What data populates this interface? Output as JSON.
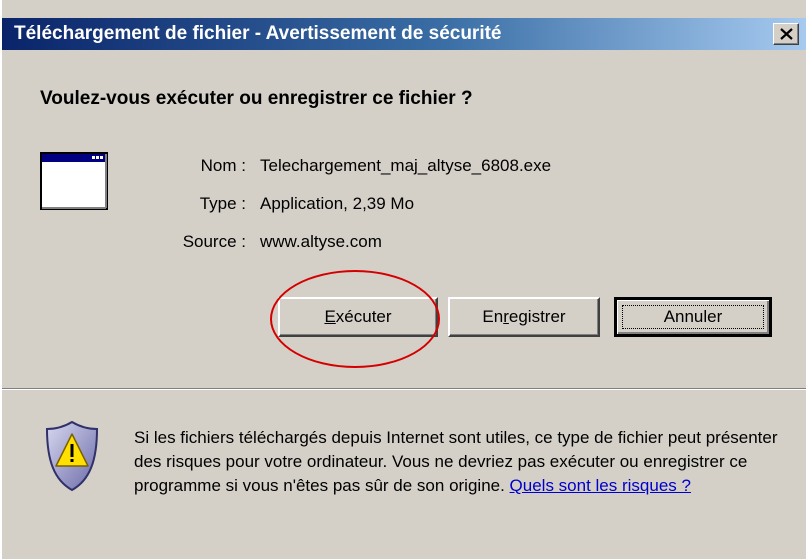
{
  "dialog": {
    "title": "Téléchargement de fichier - Avertissement de sécurité",
    "question": "Voulez-vous exécuter ou enregistrer ce fichier ?"
  },
  "file": {
    "name_label": "Nom :",
    "name_value": "Telechargement_maj_altyse_6808.exe",
    "type_label": "Type :",
    "type_value": "Application, 2,39 Mo",
    "source_label": "Source :",
    "source_value": "www.altyse.com"
  },
  "buttons": {
    "run": {
      "mnemonic": "E",
      "rest": "xécuter"
    },
    "save": {
      "before": "En",
      "mnemonic": "r",
      "after": "egistrer"
    },
    "cancel": "Annuler"
  },
  "warning": {
    "text": "Si les fichiers téléchargés depuis Internet sont utiles, ce type de fichier peut présenter des risques pour votre ordinateur. Vous ne devriez pas exécuter ou enregistrer ce programme si vous n'êtes pas sûr de son origine. ",
    "link": "Quels sont les risques ?"
  },
  "icons": {
    "window": "application-window-icon",
    "warning": "security-shield-warning-icon",
    "close": "close-icon"
  },
  "colors": {
    "titlebar_start": "#0a246a",
    "titlebar_end": "#a6caf0",
    "dialog_background": "#d4d0c8",
    "annotation": "#d40000",
    "link": "#0000cc"
  }
}
